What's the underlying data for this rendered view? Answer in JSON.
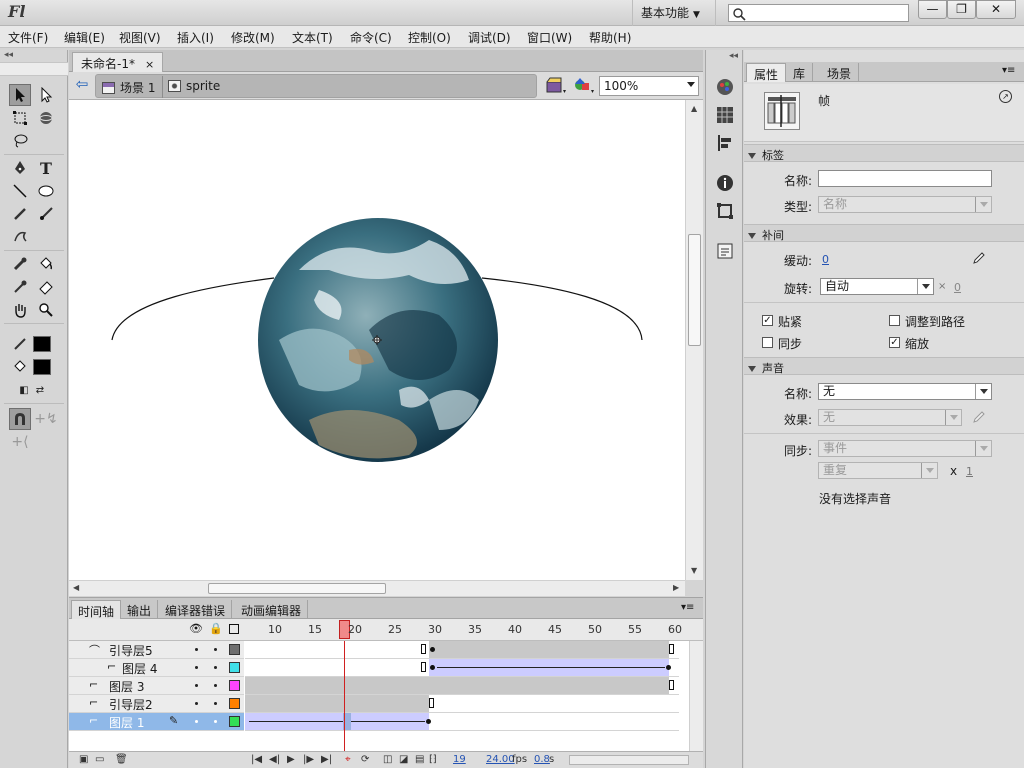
{
  "app": {
    "logo": "Fl",
    "workspace": "基本功能",
    "search_placeholder": "",
    "window_buttons": [
      "—",
      "❐",
      "✕"
    ]
  },
  "menu": [
    "文件(F)",
    "编辑(E)",
    "视图(V)",
    "插入(I)",
    "修改(M)",
    "文本(T)",
    "命令(C)",
    "控制(O)",
    "调试(D)",
    "窗口(W)",
    "帮助(H)"
  ],
  "document": {
    "tab_title": "未命名-1*",
    "tab_close": "×",
    "breadcrumb": [
      "场景 1",
      "sprite"
    ],
    "zoom": "100%"
  },
  "timeline": {
    "tabs": [
      "时间轴",
      "输出",
      "编译器错误",
      "动画编辑器"
    ],
    "frame_numbers": [
      "10",
      "15",
      "20",
      "25",
      "30",
      "35",
      "40",
      "45",
      "50",
      "55",
      "60"
    ],
    "playhead_frame": 19,
    "layers": [
      {
        "name": "引导层5",
        "kind": "guide",
        "color": "#6e6e6e",
        "selected": false
      },
      {
        "name": "图层 4",
        "kind": "guided",
        "color": "#40e0e8",
        "selected": false
      },
      {
        "name": "图层 3",
        "kind": "normal",
        "color": "#ff44ff",
        "selected": false
      },
      {
        "name": "引导层2",
        "kind": "guide",
        "color": "#ff8000",
        "selected": false
      },
      {
        "name": "图层 1",
        "kind": "guided",
        "color": "#33dd55",
        "selected": true
      }
    ],
    "status": {
      "current_frame": "19",
      "fps": "24.00",
      "fps_unit": "fps",
      "time": "0.8",
      "time_unit": "s"
    }
  },
  "properties": {
    "tabs": [
      "属性",
      "库",
      "场景"
    ],
    "header": "帧",
    "sections": {
      "label": "标签",
      "tween": "补间",
      "sound": "声音"
    },
    "label_name_label": "名称:",
    "label_name_value": "",
    "label_type_label": "类型:",
    "label_type_value": "名称",
    "ease_label": "缓动:",
    "ease_value": "0",
    "rotate_label": "旋转:",
    "rotate_value": "自动",
    "rotate_times_prefix": "×",
    "rotate_times": "0",
    "checkboxes": [
      {
        "label": "贴紧",
        "checked": true
      },
      {
        "label": "调整到路径",
        "checked": false
      },
      {
        "label": "同步",
        "checked": false
      },
      {
        "label": "缩放",
        "checked": true
      }
    ],
    "sound_name_label": "名称:",
    "sound_name_value": "无",
    "effect_label": "效果:",
    "effect_value": "无",
    "sync_label": "同步:",
    "sync_value": "事件",
    "repeat_value": "重复",
    "repeat_x": "x",
    "repeat_count": "1",
    "no_sound": "没有选择声音"
  },
  "colors": {
    "stroke": "#000000",
    "fill": "#000000",
    "selection": "#8fb8e8",
    "tween_span": "#ccccff",
    "playhead": "#d02020"
  }
}
